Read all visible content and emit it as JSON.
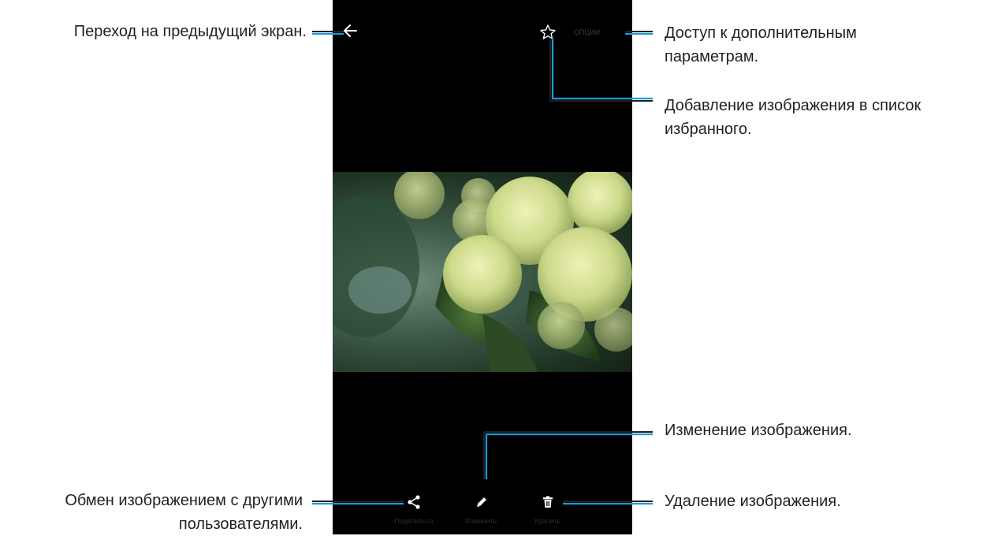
{
  "screen": {
    "more_label": "ОПЦИИ",
    "bottom_bar": {
      "share_label": "Поделиться",
      "edit_label": "Изменить",
      "delete_label": "Удалить"
    }
  },
  "callouts": {
    "back": "Переход на предыдущий экран.",
    "more_line1": "Доступ к дополнительным",
    "more_line2": "параметрам.",
    "favorite_line1": "Добавление изображения в список",
    "favorite_line2": "избранного.",
    "edit": "Изменение изображения.",
    "share_line1": "Обмен изображением с другими",
    "share_line2": "пользователями.",
    "delete": "Удаление изображения."
  },
  "colors": {
    "callout_line": "#1a9cd8",
    "phone_bg": "#000000",
    "icon": "#ffffff"
  },
  "icons": [
    "back-arrow-icon",
    "star-icon",
    "share-icon",
    "pencil-icon",
    "trash-icon"
  ]
}
